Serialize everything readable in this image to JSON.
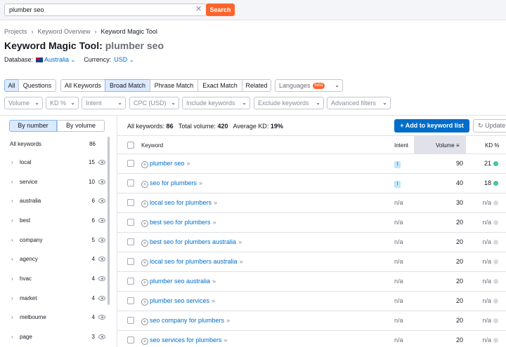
{
  "search": {
    "value": "plumber seo",
    "clear": "✕",
    "button": "Search"
  },
  "breadcrumb": {
    "items": [
      "Projects",
      "Keyword Overview",
      "Keyword Magic Tool"
    ],
    "sep": "›"
  },
  "page": {
    "title": "Keyword Magic Tool:",
    "query": "plumber seo"
  },
  "database": {
    "label": "Database:",
    "value": "Australia",
    "currency_label": "Currency:",
    "currency": "USD",
    "chevron": "⌄"
  },
  "type_tabs": [
    "All",
    "Questions"
  ],
  "match_tabs": [
    "All Keywords",
    "Broad Match",
    "Phrase Match",
    "Exact Match",
    "Related"
  ],
  "languages": {
    "label": "Languages",
    "badge": "beta"
  },
  "filters": [
    "Volume",
    "KD %",
    "Intent",
    "CPC (USD)",
    "Include keywords",
    "Exclude keywords",
    "Advanced filters"
  ],
  "sidebar": {
    "tabs": [
      "By number",
      "By volume"
    ],
    "header": {
      "label": "All keywords",
      "count": "86"
    },
    "items": [
      {
        "name": "local",
        "count": "15"
      },
      {
        "name": "service",
        "count": "10"
      },
      {
        "name": "australia",
        "count": "6"
      },
      {
        "name": "best",
        "count": "6"
      },
      {
        "name": "company",
        "count": "5"
      },
      {
        "name": "agency",
        "count": "4"
      },
      {
        "name": "hvac",
        "count": "4"
      },
      {
        "name": "market",
        "count": "4"
      },
      {
        "name": "melbourne",
        "count": "4"
      },
      {
        "name": "page",
        "count": "3"
      }
    ]
  },
  "stats": {
    "all_label": "All keywords:",
    "all": "86",
    "vol_label": "Total volume:",
    "vol": "420",
    "kd_label": "Average KD:",
    "kd": "19%"
  },
  "actions": {
    "add": "+ Add to keyword list",
    "update": "Update"
  },
  "table": {
    "headers": {
      "keyword": "Keyword",
      "intent": "Intent",
      "volume": "Volume",
      "kd": "KD %"
    },
    "rows": [
      {
        "keyword": "plumber seo",
        "intent": "I",
        "volume": "90",
        "kd": "21",
        "kd_color": "#43c98b"
      },
      {
        "keyword": "seo for plumbers",
        "intent": "I",
        "volume": "40",
        "kd": "18",
        "kd_color": "#43c98b"
      },
      {
        "keyword": "local seo for plumbers",
        "intent": "n/a",
        "volume": "30",
        "kd": "n/a",
        "kd_color": "#d8d9df"
      },
      {
        "keyword": "best seo for plumbers",
        "intent": "n/a",
        "volume": "20",
        "kd": "n/a",
        "kd_color": "#d8d9df"
      },
      {
        "keyword": "best seo for plumbers australia",
        "intent": "n/a",
        "volume": "20",
        "kd": "n/a",
        "kd_color": "#d8d9df"
      },
      {
        "keyword": "local seo for plumbers australia",
        "intent": "n/a",
        "volume": "20",
        "kd": "n/a",
        "kd_color": "#d8d9df"
      },
      {
        "keyword": "plumber seo australia",
        "intent": "n/a",
        "volume": "20",
        "kd": "n/a",
        "kd_color": "#d8d9df"
      },
      {
        "keyword": "plumber seo services",
        "intent": "n/a",
        "volume": "20",
        "kd": "n/a",
        "kd_color": "#d8d9df"
      },
      {
        "keyword": "seo company for plumbers",
        "intent": "n/a",
        "volume": "20",
        "kd": "n/a",
        "kd_color": "#d8d9df"
      },
      {
        "keyword": "seo services for plumbers",
        "intent": "n/a",
        "volume": "20",
        "kd": "n/a",
        "kd_color": "#d8d9df"
      }
    ]
  }
}
